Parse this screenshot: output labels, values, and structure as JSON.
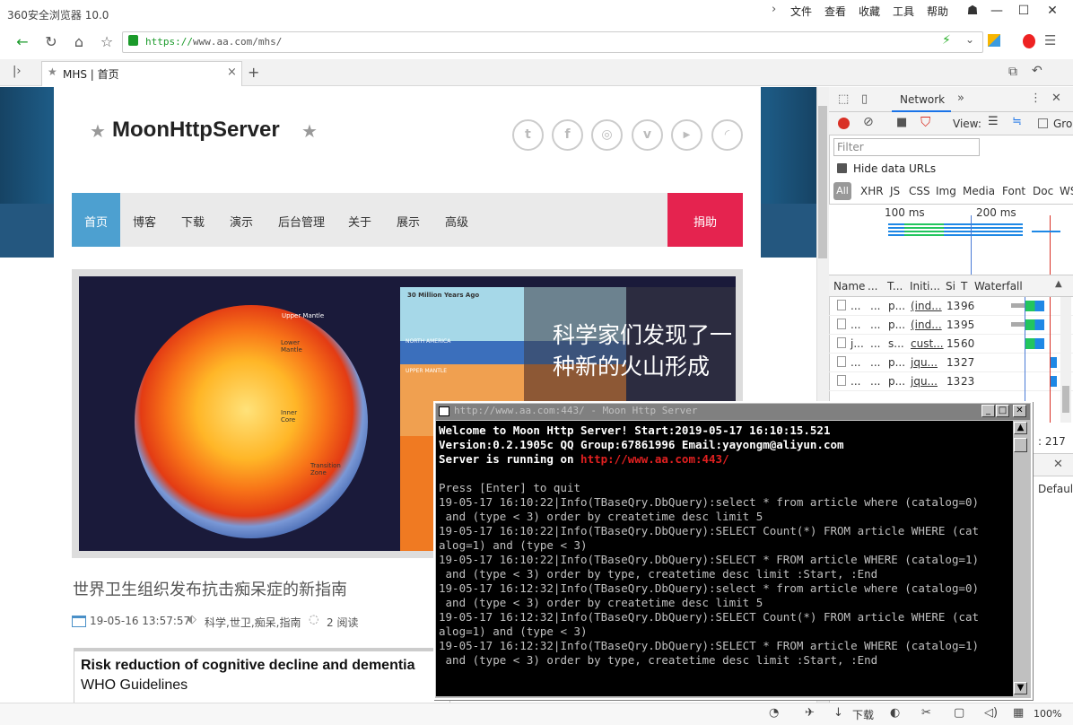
{
  "browser": {
    "app_title": "360安全浏览器 10.0",
    "menu": [
      "文件",
      "查看",
      "收藏",
      "工具",
      "帮助"
    ],
    "url_scheme": "https://",
    "url_rest": "www.aa.com/mhs/",
    "tab_label": "MHS | 首页",
    "tab_close": "×",
    "new_tab": "+"
  },
  "site": {
    "title": "MoonHttpServer",
    "nav": [
      "首页",
      "博客",
      "下载",
      "演示",
      "后台管理",
      "关于",
      "展示",
      "高级"
    ],
    "donate": "捐助",
    "hero_title": "科学家们发现了一种新的火山形成",
    "hero_caption": "30 Million Years Ago",
    "hero_na": "NORTH AMERICA",
    "hero_upper": "UPPER MANTLE",
    "earth_labels": [
      "Upper Mantle",
      "Lower Mantle",
      "Inner Core",
      "Transition Zone"
    ],
    "article_title": "世界卫生组织发布抗击痴呆症的新指南",
    "meta_date": "19-05-16 13:57:57",
    "meta_tags": "科学,世卫,痴呆,指南",
    "meta_reads": "2 阅读",
    "excerpt_title": "Risk reduction of cognitive decline and dementia",
    "excerpt_sub": "WHO Guidelines"
  },
  "devtools": {
    "tab": "Network",
    "view_label": "View:",
    "group_label": "Gro",
    "filter_placeholder": "Filter",
    "hide_data_urls": "Hide data URLs",
    "types": [
      "All",
      "XHR",
      "JS",
      "CSS",
      "Img",
      "Media",
      "Font",
      "Doc",
      "WS"
    ],
    "timeline": [
      "100 ms",
      "200 ms"
    ],
    "columns": [
      "Name",
      "...",
      "T...",
      "Initi...",
      "Si",
      "T",
      "Waterfall"
    ],
    "rows": [
      {
        "name": "...",
        "s": "...",
        "t": "p...",
        "init": "(ind...",
        "size": "13",
        "time": "96"
      },
      {
        "name": "...",
        "s": "...",
        "t": "p...",
        "init": "(ind...",
        "size": "13",
        "time": "95"
      },
      {
        "name": "j...",
        "s": "...",
        "t": "s...",
        "init": "cust...",
        "size": "15",
        "time": "60"
      },
      {
        "name": "...",
        "s": "...",
        "t": "p...",
        "init": "jqu...",
        "size": "13",
        "time": "27"
      },
      {
        "name": "...",
        "s": "...",
        "t": "p...",
        "init": "jqu...",
        "size": "13",
        "time": "23"
      }
    ],
    "count": ": 217",
    "default": "Default"
  },
  "console": {
    "title": "http://www.aa.com:443/ - Moon Http Server",
    "lines": [
      {
        "text": "Welcome to Moon Http Server! Start:2019-05-17 16:10:15.521",
        "style": "bold"
      },
      {
        "text": "Version:0.2.1905c QQ Group:67861996 Email:yayongm@aliyun.com",
        "style": "bold"
      },
      {
        "text": "Server is running on ",
        "style": "bold",
        "link": "http://www.aa.com:443/"
      },
      {
        "text": "",
        "style": "normal"
      },
      {
        "text": "Press [Enter] to quit",
        "style": "normal"
      },
      {
        "text": "19-05-17 16:10:22|Info(TBaseQry.DbQuery):select * from article where (catalog=0)",
        "style": "normal"
      },
      {
        "text": " and (type < 3) order by createtime desc limit 5",
        "style": "normal"
      },
      {
        "text": "19-05-17 16:10:22|Info(TBaseQry.DbQuery):SELECT Count(*) FROM article WHERE (cat",
        "style": "normal"
      },
      {
        "text": "alog=1) and (type < 3)",
        "style": "normal"
      },
      {
        "text": "19-05-17 16:10:22|Info(TBaseQry.DbQuery):SELECT * FROM article WHERE (catalog=1)",
        "style": "normal"
      },
      {
        "text": " and (type < 3) order by type, createtime desc limit :Start, :End",
        "style": "normal"
      },
      {
        "text": "19-05-17 16:12:32|Info(TBaseQry.DbQuery):select * from article where (catalog=0)",
        "style": "normal"
      },
      {
        "text": " and (type < 3) order by createtime desc limit 5",
        "style": "normal"
      },
      {
        "text": "19-05-17 16:12:32|Info(TBaseQry.DbQuery):SELECT Count(*) FROM article WHERE (cat",
        "style": "normal"
      },
      {
        "text": "alog=1) and (type < 3)",
        "style": "normal"
      },
      {
        "text": "19-05-17 16:12:32|Info(TBaseQry.DbQuery):SELECT * FROM article WHERE (catalog=1)",
        "style": "normal"
      },
      {
        "text": " and (type < 3) order by type, createtime desc limit :Start, :End",
        "style": "normal"
      }
    ]
  },
  "statusbar": {
    "download": "下载",
    "zoom": "100%"
  },
  "colors": {
    "accent": "#4da0d0",
    "donate": "#e5234f",
    "url_green": "#1a9a2a"
  }
}
